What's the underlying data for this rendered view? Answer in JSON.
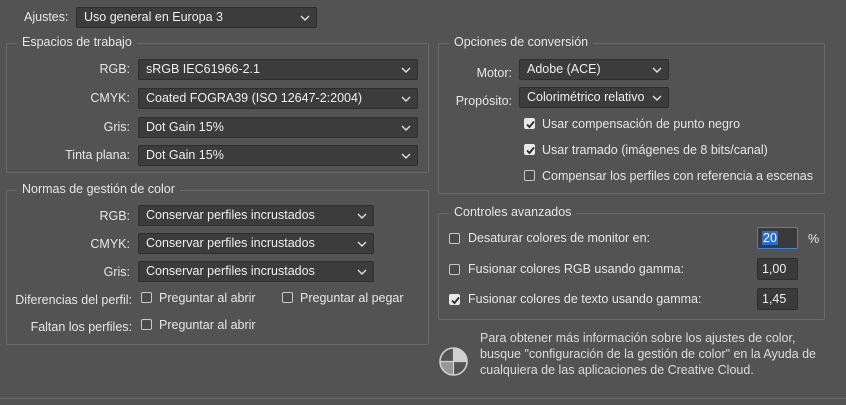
{
  "ajustes": {
    "label": "Ajustes:",
    "value": "Uso general en Europa 3"
  },
  "workspaces": {
    "title": "Espacios de trabajo",
    "rows": [
      {
        "label": "RGB:",
        "value": "sRGB IEC61966-2.1"
      },
      {
        "label": "CMYK:",
        "value": "Coated FOGRA39 (ISO 12647-2:2004)"
      },
      {
        "label": "Gris:",
        "value": "Dot Gain 15%"
      },
      {
        "label": "Tinta plana:",
        "value": "Dot Gain 15%"
      }
    ]
  },
  "policies": {
    "title": "Normas de gestión de color",
    "rows": [
      {
        "label": "RGB:",
        "value": "Conservar perfiles incrustados"
      },
      {
        "label": "CMYK:",
        "value": "Conservar perfiles incrustados"
      },
      {
        "label": "Gris:",
        "value": "Conservar perfiles incrustados"
      }
    ],
    "mismatch_label": "Diferencias del perfil:",
    "mismatch_open": {
      "label": "Preguntar al abrir",
      "checked": false
    },
    "mismatch_paste": {
      "label": "Preguntar al pegar",
      "checked": false
    },
    "missing_label": "Faltan los perfiles:",
    "missing_open": {
      "label": "Preguntar al abrir",
      "checked": false
    }
  },
  "conversion": {
    "title": "Opciones de conversión",
    "engine_label": "Motor:",
    "engine_value": "Adobe (ACE)",
    "intent_label": "Propósito:",
    "intent_value": "Colorimétrico relativo",
    "options": [
      {
        "label": "Usar compensación de punto negro",
        "checked": true
      },
      {
        "label": "Usar tramado (imágenes de 8 bits/canal)",
        "checked": true
      },
      {
        "label": "Compensar los perfiles con referencia a escenas",
        "checked": false
      }
    ]
  },
  "advanced": {
    "title": "Controles avanzados",
    "desaturate": {
      "label": "Desaturar colores de monitor en:",
      "checked": false,
      "value": "20",
      "unit": "%"
    },
    "blend_rgb": {
      "label": "Fusionar colores RGB usando gamma:",
      "checked": false,
      "value": "1,00"
    },
    "blend_text": {
      "label": "Fusionar colores de texto usando gamma:",
      "checked": true,
      "value": "1,45"
    }
  },
  "info": {
    "icon": "color-settings-icon",
    "lines": [
      "Para obtener más información sobre los ajustes de color,",
      "busque \"configuración de la gestión de color\" en la Ayuda de",
      "cualquiera de las aplicaciones de Creative Cloud."
    ]
  },
  "colors": {
    "background": "#535353",
    "field": "#3c3c3c",
    "focus": "#3a86d4",
    "selection": "#2c6bd1"
  }
}
